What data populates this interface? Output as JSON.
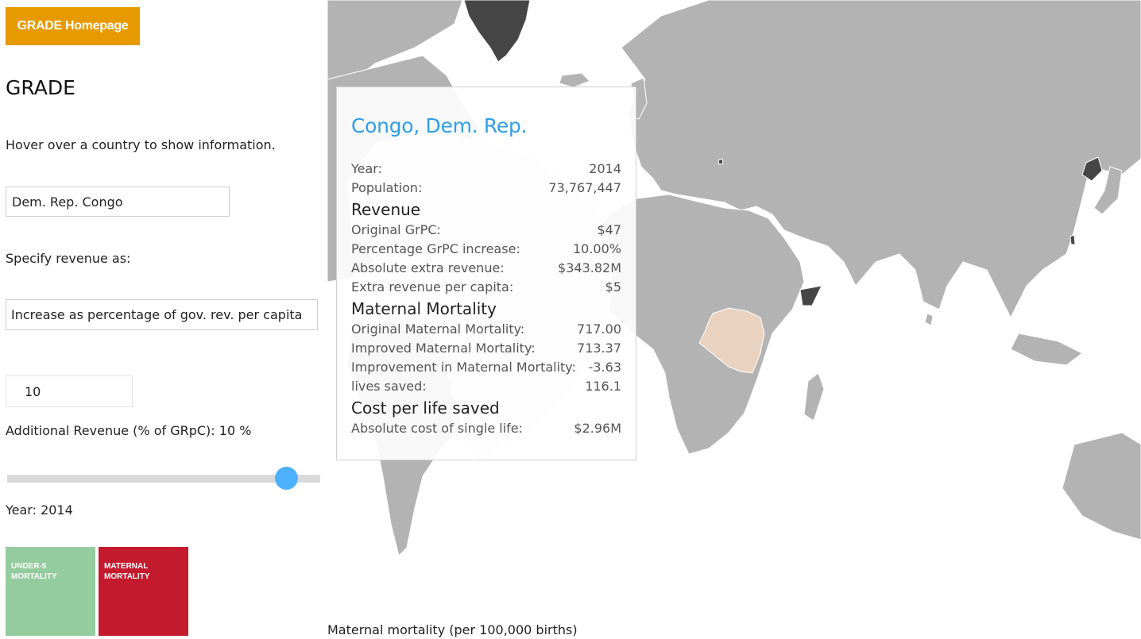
{
  "sidebar": {
    "home_button": "GRADE Homepage",
    "title": "GRADE",
    "hover_hint": "Hover over a country to show information.",
    "country_value": "Dem. Rep. Congo",
    "revenue_label": "Specify revenue as:",
    "revenue_option": "Increase as percentage of gov. rev. per capita",
    "amount_value": "10",
    "additional_revenue_label": "Additional Revenue (% of GRpC): 10 %",
    "year_label": "Year: 2014",
    "tiles": [
      {
        "label": "UNDER-5 MORTALITY",
        "line1": "UNDER-5",
        "line2": "MORTALITY",
        "color": "#94cc9f"
      },
      {
        "label": "MATERNAL MORTALITY",
        "line1": "MATERNAL",
        "line2": "MORTALITY",
        "color": "#c41a2e"
      }
    ]
  },
  "map": {
    "legend_label": "Maternal mortality (per 100,000 births)",
    "colors": {
      "land": "#b3b3b3",
      "highlight": "#e9d2c0",
      "dark": "#464646",
      "border": "#ffffff"
    }
  },
  "tooltip": {
    "title": "Congo, Dem. Rep.",
    "rows_general": [
      {
        "label": "Year:",
        "value": "2014"
      },
      {
        "label": "Population:",
        "value": "73,767,447"
      }
    ],
    "section_revenue": "Revenue",
    "rows_revenue": [
      {
        "label": "Original GrPC:",
        "value": "$47"
      },
      {
        "label": "Percentage GrPC increase:",
        "value": "10.00%"
      },
      {
        "label": "Absolute extra revenue:",
        "value": "$343.82M"
      },
      {
        "label": "Extra revenue per capita:",
        "value": "$5"
      }
    ],
    "section_mortality": "Maternal Mortality",
    "rows_mortality": [
      {
        "label": "Original Maternal Mortality:",
        "value": "717.00"
      },
      {
        "label": "Improved Maternal Mortality:",
        "value": "713.37"
      },
      {
        "label": "Improvement in Maternal Mortality:",
        "value": "-3.63"
      },
      {
        "label": "lives saved:",
        "value": "116.1"
      }
    ],
    "section_cost": "Cost per life saved",
    "rows_cost": [
      {
        "label": "Absolute cost of single life:",
        "value": "$2.96M"
      }
    ]
  }
}
